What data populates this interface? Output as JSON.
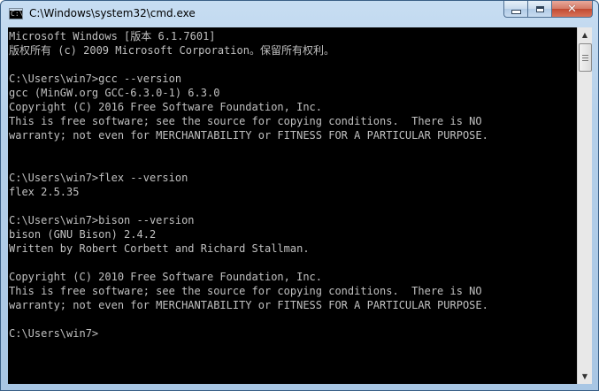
{
  "window": {
    "title": "C:\\Windows\\system32\\cmd.exe",
    "icon": "cmd-console-icon",
    "icon_glyph": "C:\\"
  },
  "caption_buttons": {
    "minimize_icon": "minimize-icon",
    "maximize_icon": "maximize-icon",
    "close_icon": "close-icon",
    "close_glyph": "✕"
  },
  "scrollbar": {
    "up_glyph": "▲",
    "down_glyph": "▼"
  },
  "console": {
    "background": "#000000",
    "foreground": "#c0c0c0",
    "lines": [
      "Microsoft Windows [版本 6.1.7601]",
      "版权所有 (c) 2009 Microsoft Corporation。保留所有权利。",
      "",
      "C:\\Users\\win7>gcc --version",
      "gcc (MinGW.org GCC-6.3.0-1) 6.3.0",
      "Copyright (C) 2016 Free Software Foundation, Inc.",
      "This is free software; see the source for copying conditions.  There is NO",
      "warranty; not even for MERCHANTABILITY or FITNESS FOR A PARTICULAR PURPOSE.",
      "",
      "",
      "C:\\Users\\win7>flex --version",
      "flex 2.5.35",
      "",
      "C:\\Users\\win7>bison --version",
      "bison (GNU Bison) 2.4.2",
      "Written by Robert Corbett and Richard Stallman.",
      "",
      "Copyright (C) 2010 Free Software Foundation, Inc.",
      "This is free software; see the source for copying conditions.  There is NO",
      "warranty; not even for MERCHANTABILITY or FITNESS FOR A PARTICULAR PURPOSE.",
      "",
      "C:\\Users\\win7>"
    ]
  }
}
